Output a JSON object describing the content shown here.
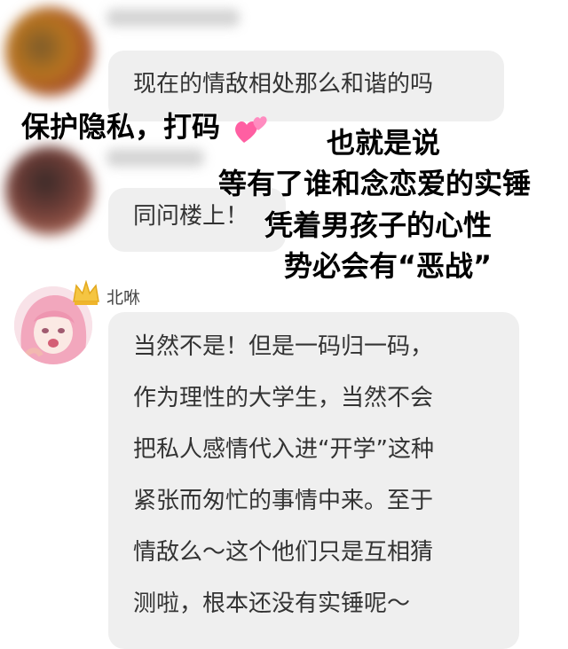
{
  "messages": [
    {
      "text": "现在的情敌相处那么和谐的吗"
    },
    {
      "text": "同问楼上！"
    }
  ],
  "overlay": {
    "privacy_note": "保护隐私，打码",
    "lines": [
      "也就是说",
      "等有了谁和念恋爱的实锤",
      "凭着男孩子的心性",
      "势必会有“恶战”"
    ]
  },
  "reply": {
    "username": "北咻",
    "lines": [
      "当然不是！但是一码归一码，",
      "作为理性的大学生，当然不会",
      "把私人感情代入进“开学”这种",
      "紧张而匆忙的事情中来。至于",
      "情敌么～这个他们只是互相猜",
      "测啦，根本还没有实锤呢～"
    ]
  },
  "colors": {
    "bubble_bg": "#efefef",
    "heart": "#ff5fa2",
    "crown": "#f5c542"
  },
  "icons": [
    "sparkling-heart-icon",
    "crown-icon"
  ]
}
